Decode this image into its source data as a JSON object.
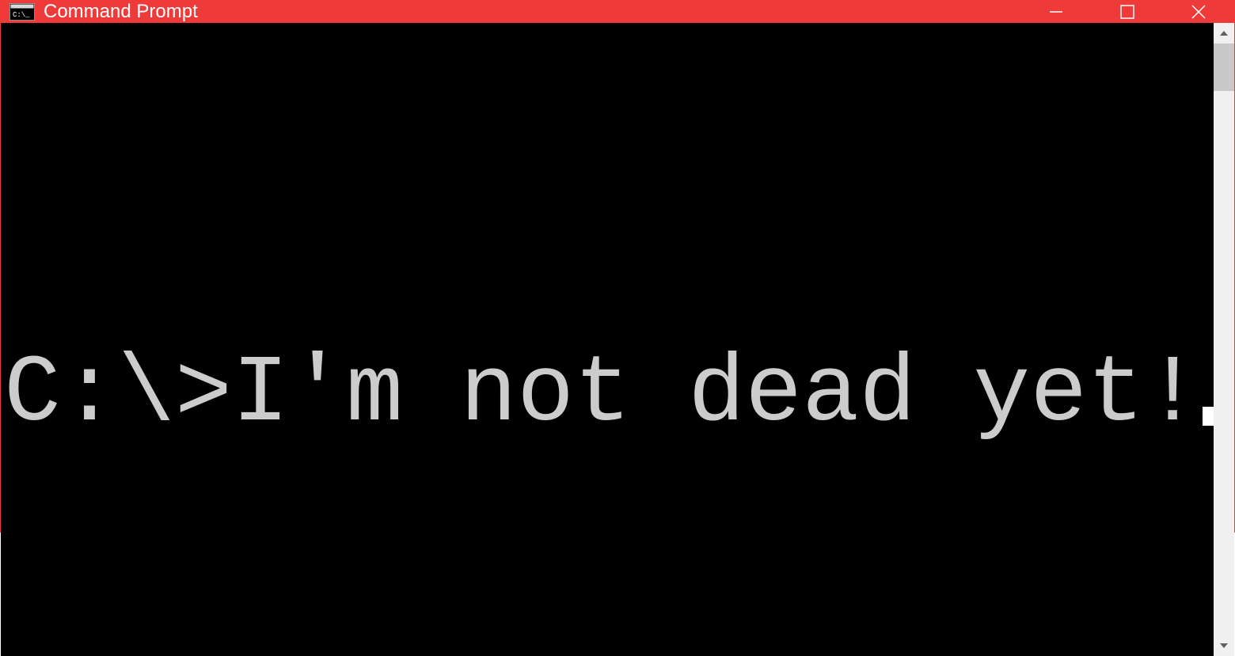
{
  "window": {
    "title": "Command Prompt",
    "titlebar_color": "#ef3a3a"
  },
  "terminal": {
    "prompt": "C:\\>",
    "command": "I'm not dead yet!",
    "text_color": "#cccccc",
    "background": "#000000"
  },
  "icons": {
    "app": "cmd-icon",
    "minimize": "minimize-icon",
    "maximize": "maximize-icon",
    "close": "close-icon",
    "scroll_up": "chevron-up-icon",
    "scroll_down": "chevron-down-icon"
  }
}
